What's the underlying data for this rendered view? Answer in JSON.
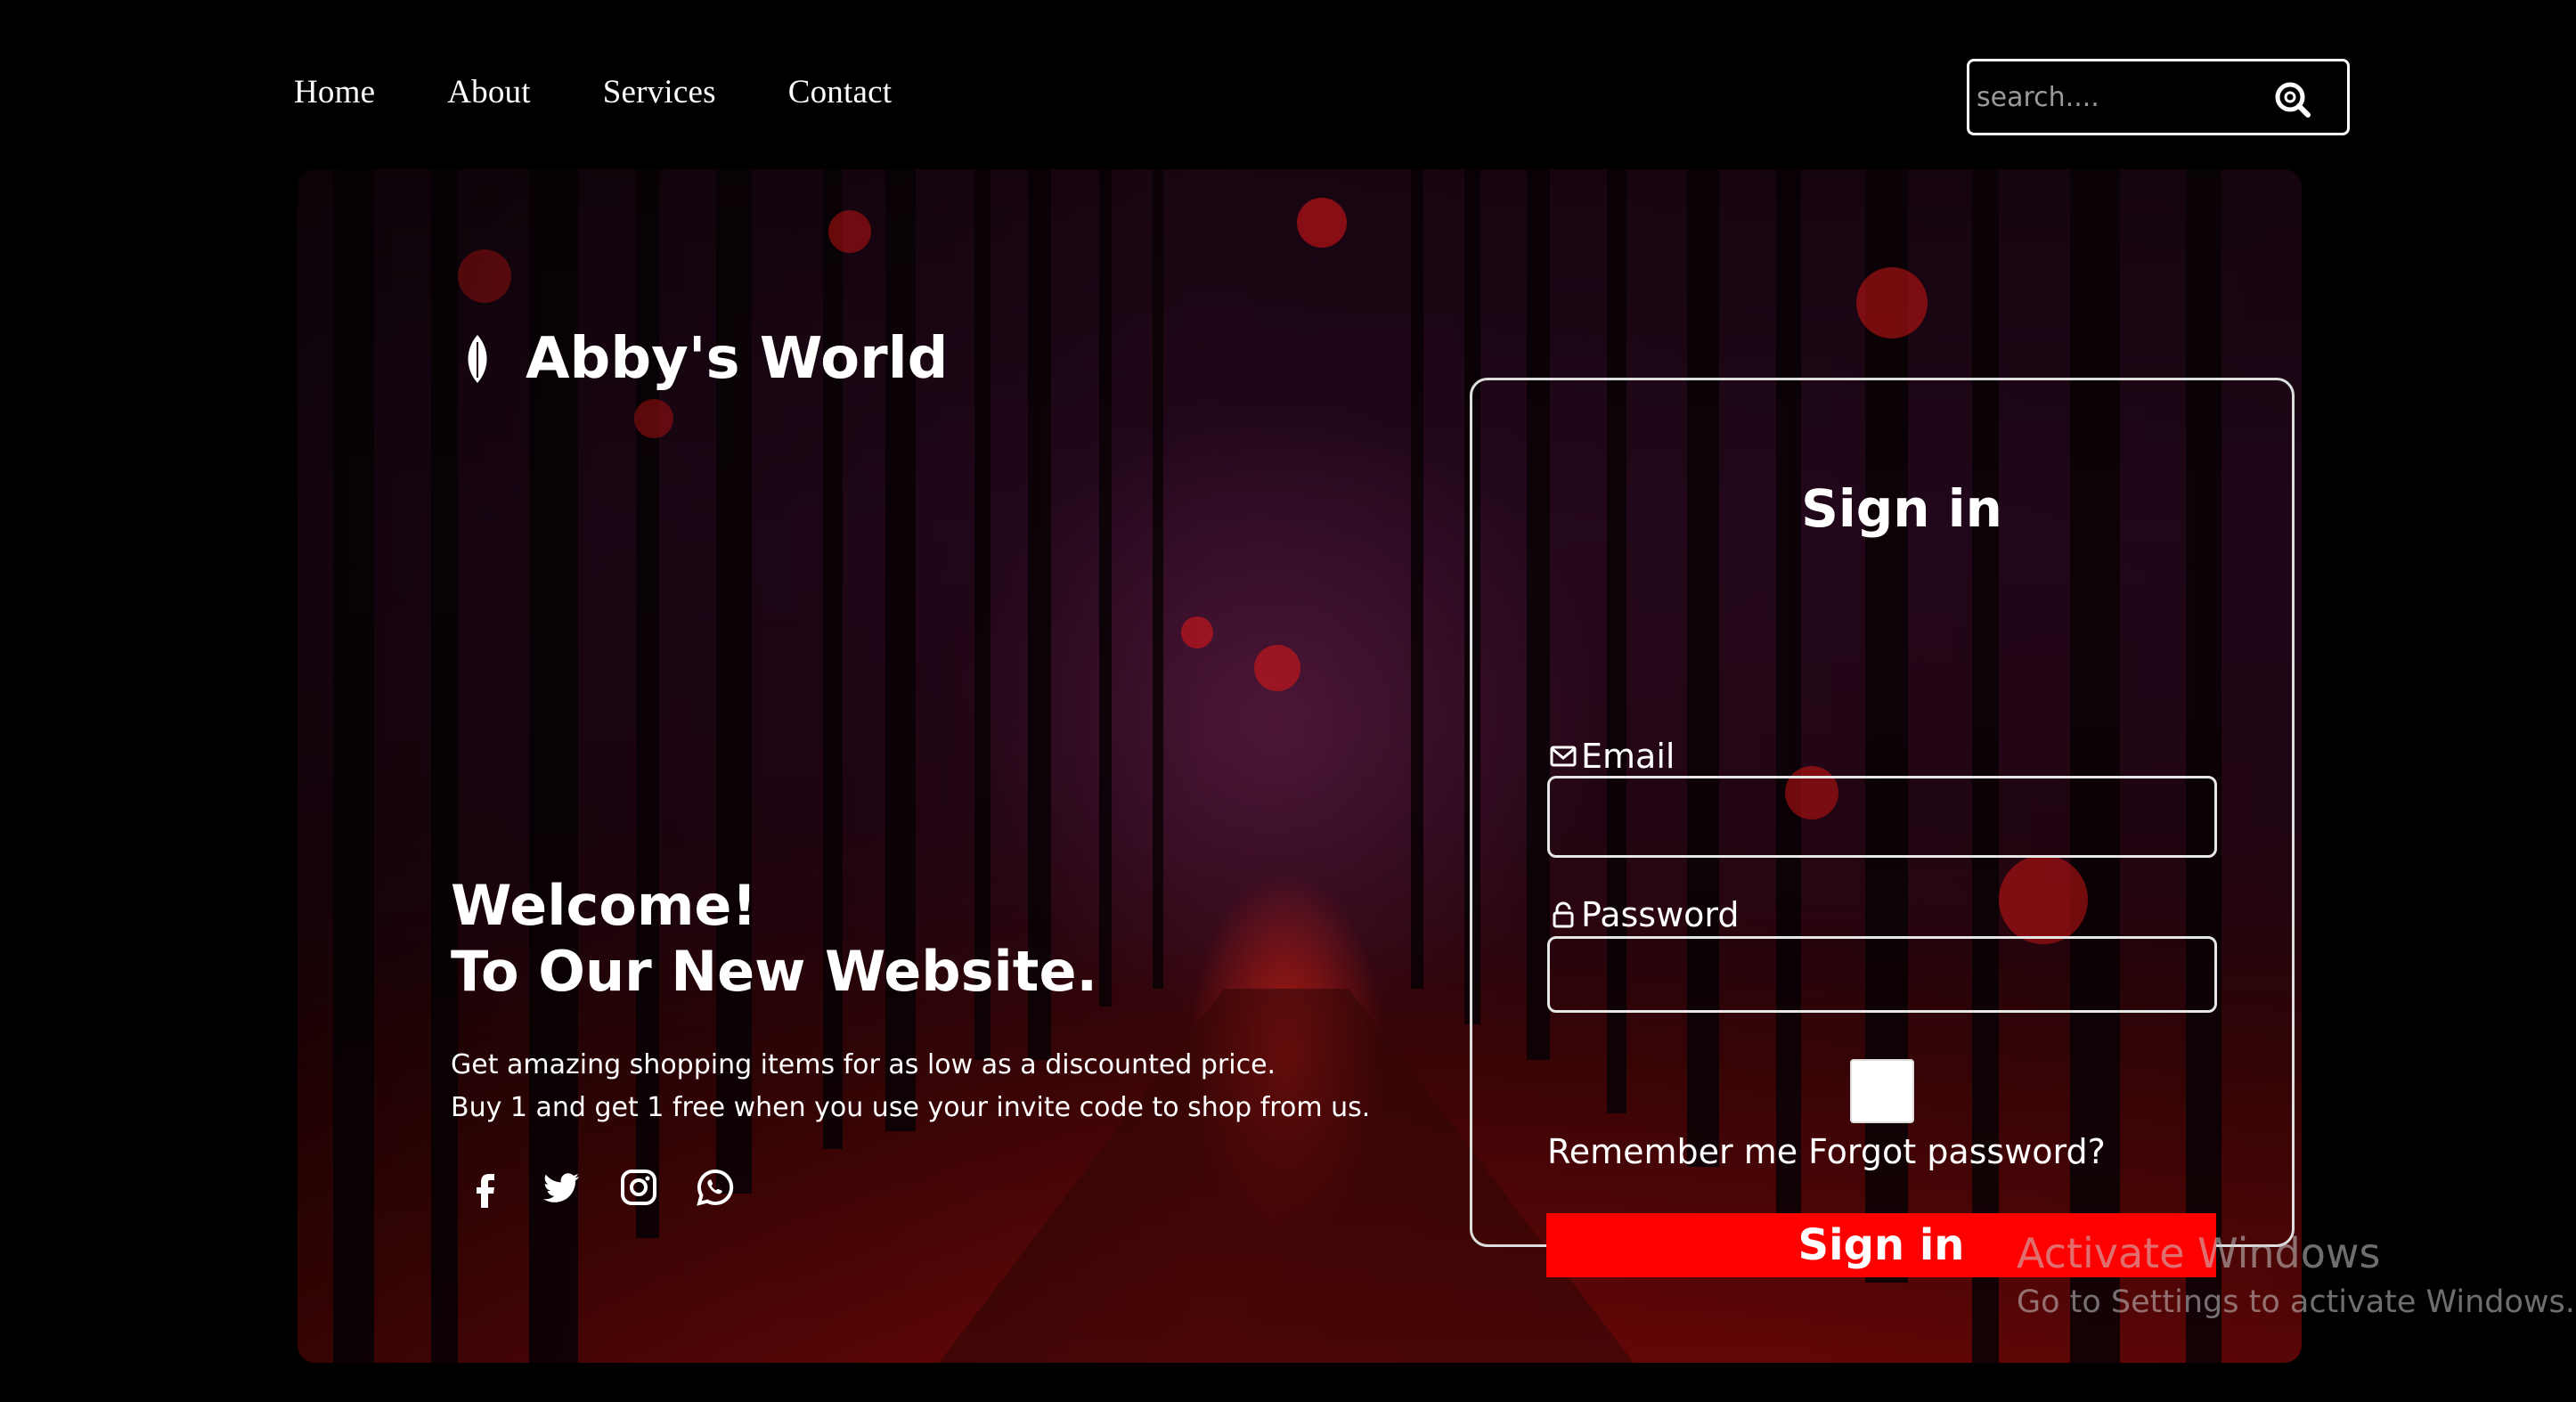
{
  "nav": {
    "items": [
      "Home",
      "About",
      "Services",
      "Contact"
    ]
  },
  "search": {
    "placeholder": "search...."
  },
  "brand": {
    "name": "Abby's World"
  },
  "hero": {
    "welcome_line1": "Welcome!",
    "welcome_line2": "To Our New Website.",
    "desc_line1": "Get amazing shopping items for as low as a discounted price.",
    "desc_line2": "Buy 1 and get 1 free when you use your invite code to shop from us.",
    "socials": [
      "facebook-icon",
      "twitter-icon",
      "instagram-icon",
      "whatsapp-icon"
    ]
  },
  "login": {
    "title": "Sign in",
    "email_label": "Email",
    "password_label": "Password",
    "remember_text": "Remember me Forgot password?",
    "submit_label": "Sign in"
  },
  "watermark": {
    "line1": "Activate Windows",
    "line2": "Go to Settings to activate Windows."
  },
  "colors": {
    "accent": "#ff0000",
    "background": "#000000"
  }
}
